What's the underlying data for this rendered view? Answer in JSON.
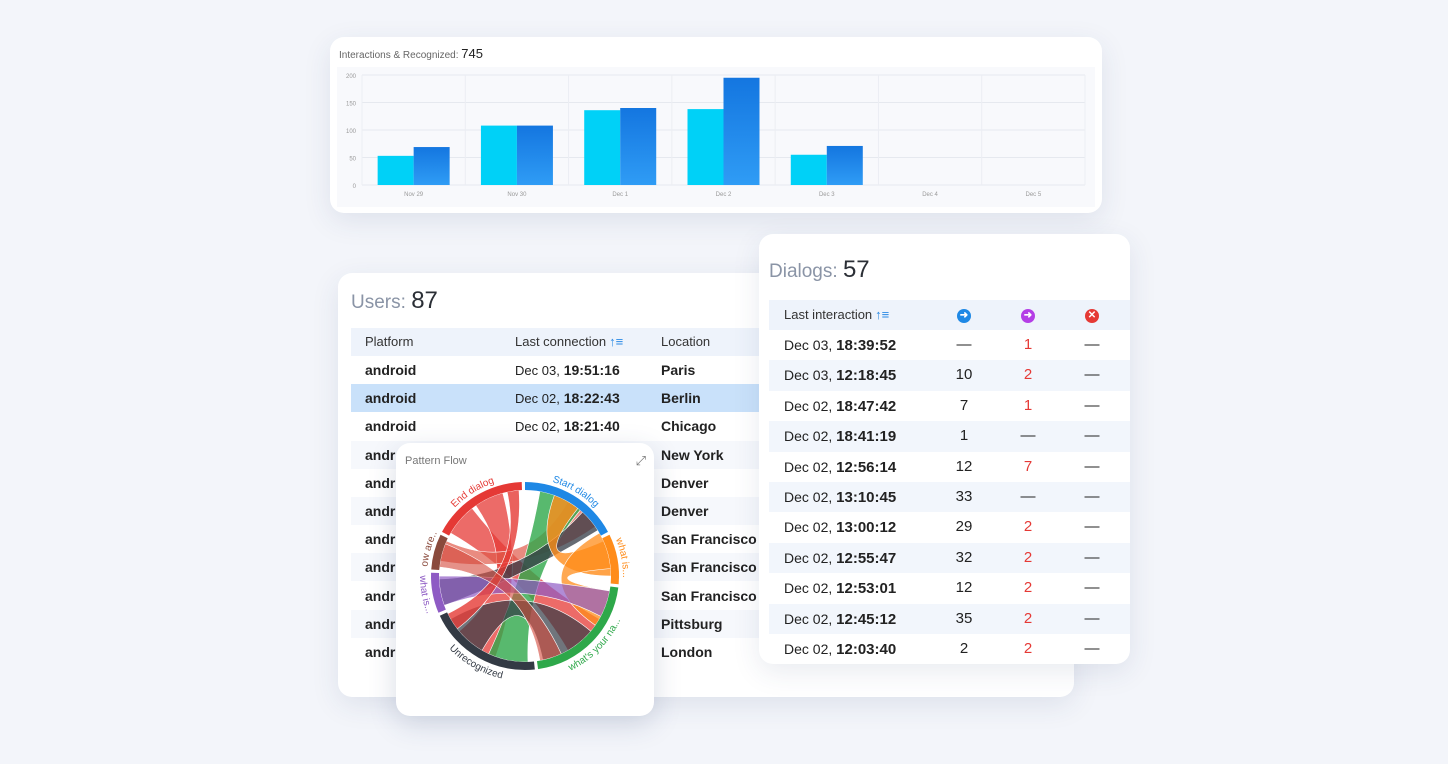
{
  "interactions_chart": {
    "title_label": "Interactions & Recognized:",
    "title_value": "745",
    "colors": {
      "interactions": "#00d1f7",
      "recognized": "#1a86e8"
    },
    "chart_data": {
      "type": "bar",
      "categories": [
        "Nov 29",
        "Nov 30",
        "Dec 1",
        "Dec 2",
        "Dec 3",
        "Dec 4",
        "Dec 5"
      ],
      "series": [
        {
          "values": [
            53,
            108,
            136,
            138,
            55,
            0,
            0
          ]
        },
        {
          "values": [
            69,
            108,
            140,
            195,
            71,
            0,
            0
          ]
        }
      ],
      "yticks": [
        "0",
        "50",
        "100",
        "150",
        "200"
      ],
      "ylim": [
        0,
        200
      ],
      "grid": true
    }
  },
  "users": {
    "title_label": "Users:",
    "title_value": "87",
    "columns": {
      "platform": "Platform",
      "last_connection": "Last connection",
      "location": "Location"
    },
    "rows": [
      {
        "platform": "android",
        "date": "Dec 03,",
        "time": "19:51:16",
        "location": "Paris"
      },
      {
        "platform": "android",
        "date": "Dec 02,",
        "time": "18:22:43",
        "location": "Berlin"
      },
      {
        "platform": "android",
        "date": "Dec 02,",
        "time": "18:21:40",
        "location": "Chicago"
      },
      {
        "platform": "andr",
        "date": "",
        "time": "",
        "location": "New York"
      },
      {
        "platform": "andr",
        "date": "",
        "time": "",
        "location": "Denver"
      },
      {
        "platform": "andr",
        "date": "",
        "time": "",
        "location": "Denver"
      },
      {
        "platform": "andr",
        "date": "",
        "time": "",
        "location": "San Francisco"
      },
      {
        "platform": "andr",
        "date": "",
        "time": "",
        "location": "San Francisco"
      },
      {
        "platform": "andr",
        "date": "",
        "time": "",
        "location": "San Francisco"
      },
      {
        "platform": "andr",
        "date": "",
        "time": "",
        "location": "Pittsburg"
      },
      {
        "platform": "andr",
        "date": "",
        "time": "",
        "location": "London"
      }
    ],
    "selected_row": 1
  },
  "dialogs": {
    "title_label": "Dialogs:",
    "title_value": "57",
    "columns": {
      "last_interaction": "Last interaction"
    },
    "icons": [
      "blue-arrow-circle-icon",
      "purple-arrow-circle-icon",
      "red-x-circle-icon"
    ],
    "icon_colors": [
      "#1e88e5",
      "#b43ee6",
      "#e53935"
    ],
    "rows": [
      {
        "date": "Dec 03,",
        "time": "18:39:52",
        "c1": "—",
        "c2": "1",
        "c3": "—"
      },
      {
        "date": "Dec 03,",
        "time": "12:18:45",
        "c1": "10",
        "c2": "2",
        "c3": "—"
      },
      {
        "date": "Dec 02,",
        "time": "18:47:42",
        "c1": "7",
        "c2": "1",
        "c3": "—"
      },
      {
        "date": "Dec 02,",
        "time": "18:41:19",
        "c1": "1",
        "c2": "—",
        "c3": "—"
      },
      {
        "date": "Dec 02,",
        "time": "12:56:14",
        "c1": "12",
        "c2": "7",
        "c3": "—"
      },
      {
        "date": "Dec 02,",
        "time": "13:10:45",
        "c1": "33",
        "c2": "—",
        "c3": "—"
      },
      {
        "date": "Dec 02,",
        "time": "13:00:12",
        "c1": "29",
        "c2": "2",
        "c3": "—"
      },
      {
        "date": "Dec 02,",
        "time": "12:55:47",
        "c1": "32",
        "c2": "2",
        "c3": "—"
      },
      {
        "date": "Dec 02,",
        "time": "12:53:01",
        "c1": "12",
        "c2": "2",
        "c3": "—"
      },
      {
        "date": "Dec 02,",
        "time": "12:45:12",
        "c1": "35",
        "c2": "2",
        "c3": "—"
      },
      {
        "date": "Dec 02,",
        "time": "12:03:40",
        "c1": "2",
        "c2": "2",
        "c3": "—"
      }
    ]
  },
  "pattern_flow": {
    "title": "Pattern Flow",
    "expand_icon": "expand-icon",
    "groups": [
      {
        "label": "Start dialog",
        "color": "#1e88e5"
      },
      {
        "label": "what is...",
        "color": "#ff8c1a"
      },
      {
        "label": "what's your na...",
        "color": "#2ea84a"
      },
      {
        "label": "Unrecognized",
        "color": "#333a44"
      },
      {
        "label": "what is...",
        "color": "#8e5bc4"
      },
      {
        "label": "how are...",
        "color": "#8a4a3c"
      },
      {
        "label": "End dialog",
        "color": "#e53935"
      }
    ]
  }
}
